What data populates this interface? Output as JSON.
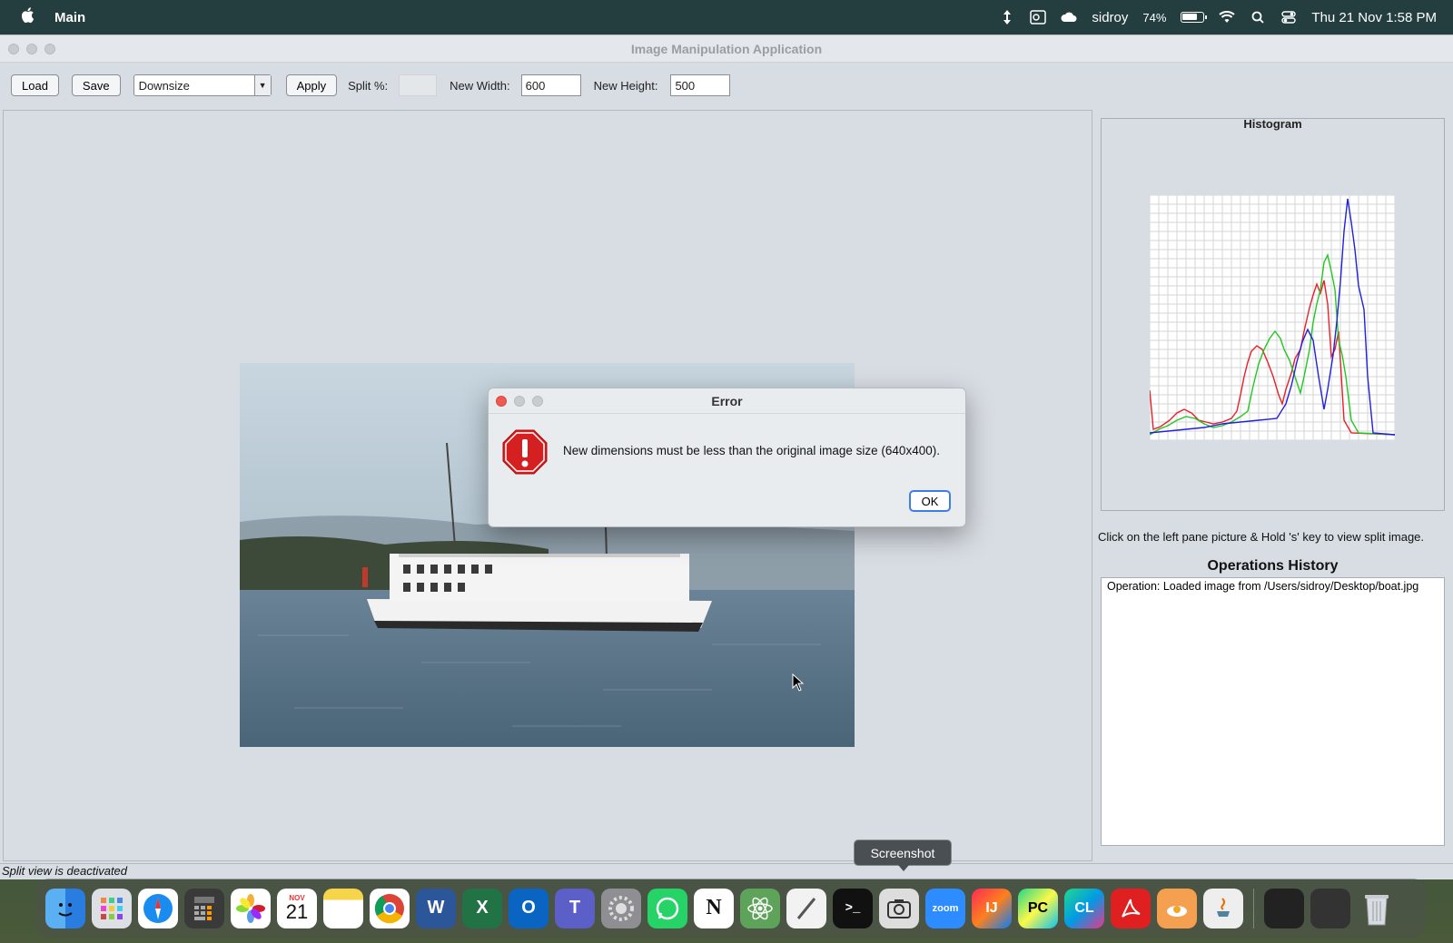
{
  "menubar": {
    "app_name": "Main",
    "user": "sidroy",
    "battery": "74%",
    "datetime": "Thu 21 Nov  1:58 PM",
    "icons": [
      "apple-icon",
      "arrow-updown-icon",
      "outlook-menu-icon",
      "cloud-icon",
      "battery-icon",
      "wifi-icon",
      "search-icon",
      "control-center-icon"
    ]
  },
  "window": {
    "title": "Image Manipulation Application"
  },
  "toolbar": {
    "load_label": "Load",
    "save_label": "Save",
    "operation_selected": "Downsize",
    "apply_label": "Apply",
    "split_label": "Split %:",
    "split_value": "",
    "width_label": "New Width:",
    "width_value": "600",
    "height_label": "New Height:",
    "height_value": "500"
  },
  "histogram": {
    "title": "Histogram",
    "colors": {
      "red": "#e8202a",
      "green": "#22c822",
      "blue": "#2020e0"
    }
  },
  "hint": "Click on the left pane picture & Hold 's' key to view split image.",
  "operations": {
    "title": "Operations History",
    "items": [
      "Operation: Loaded image from /Users/sidroy/Desktop/boat.jpg"
    ]
  },
  "status": "Split view is deactivated",
  "dialog": {
    "title": "Error",
    "message": "New dimensions must be less than the original image size (640x400).",
    "ok_label": "OK"
  },
  "tooltip": "Screenshot",
  "dock": {
    "calendar_month": "NOV",
    "calendar_day": "21",
    "apps": [
      "Finder",
      "Launchpad",
      "Safari",
      "Calculator",
      "Photos",
      "Calendar",
      "Notes",
      "Chrome",
      "Word",
      "Excel",
      "Outlook",
      "Teams",
      "System Settings",
      "WhatsApp",
      "Notion",
      "Atom",
      "TextEdit",
      "Terminal",
      "Screenshot",
      "Zoom",
      "IntelliJ",
      "PyCharm",
      "CLion",
      "Acrobat",
      "Cooking",
      "Java",
      "Trash"
    ]
  }
}
